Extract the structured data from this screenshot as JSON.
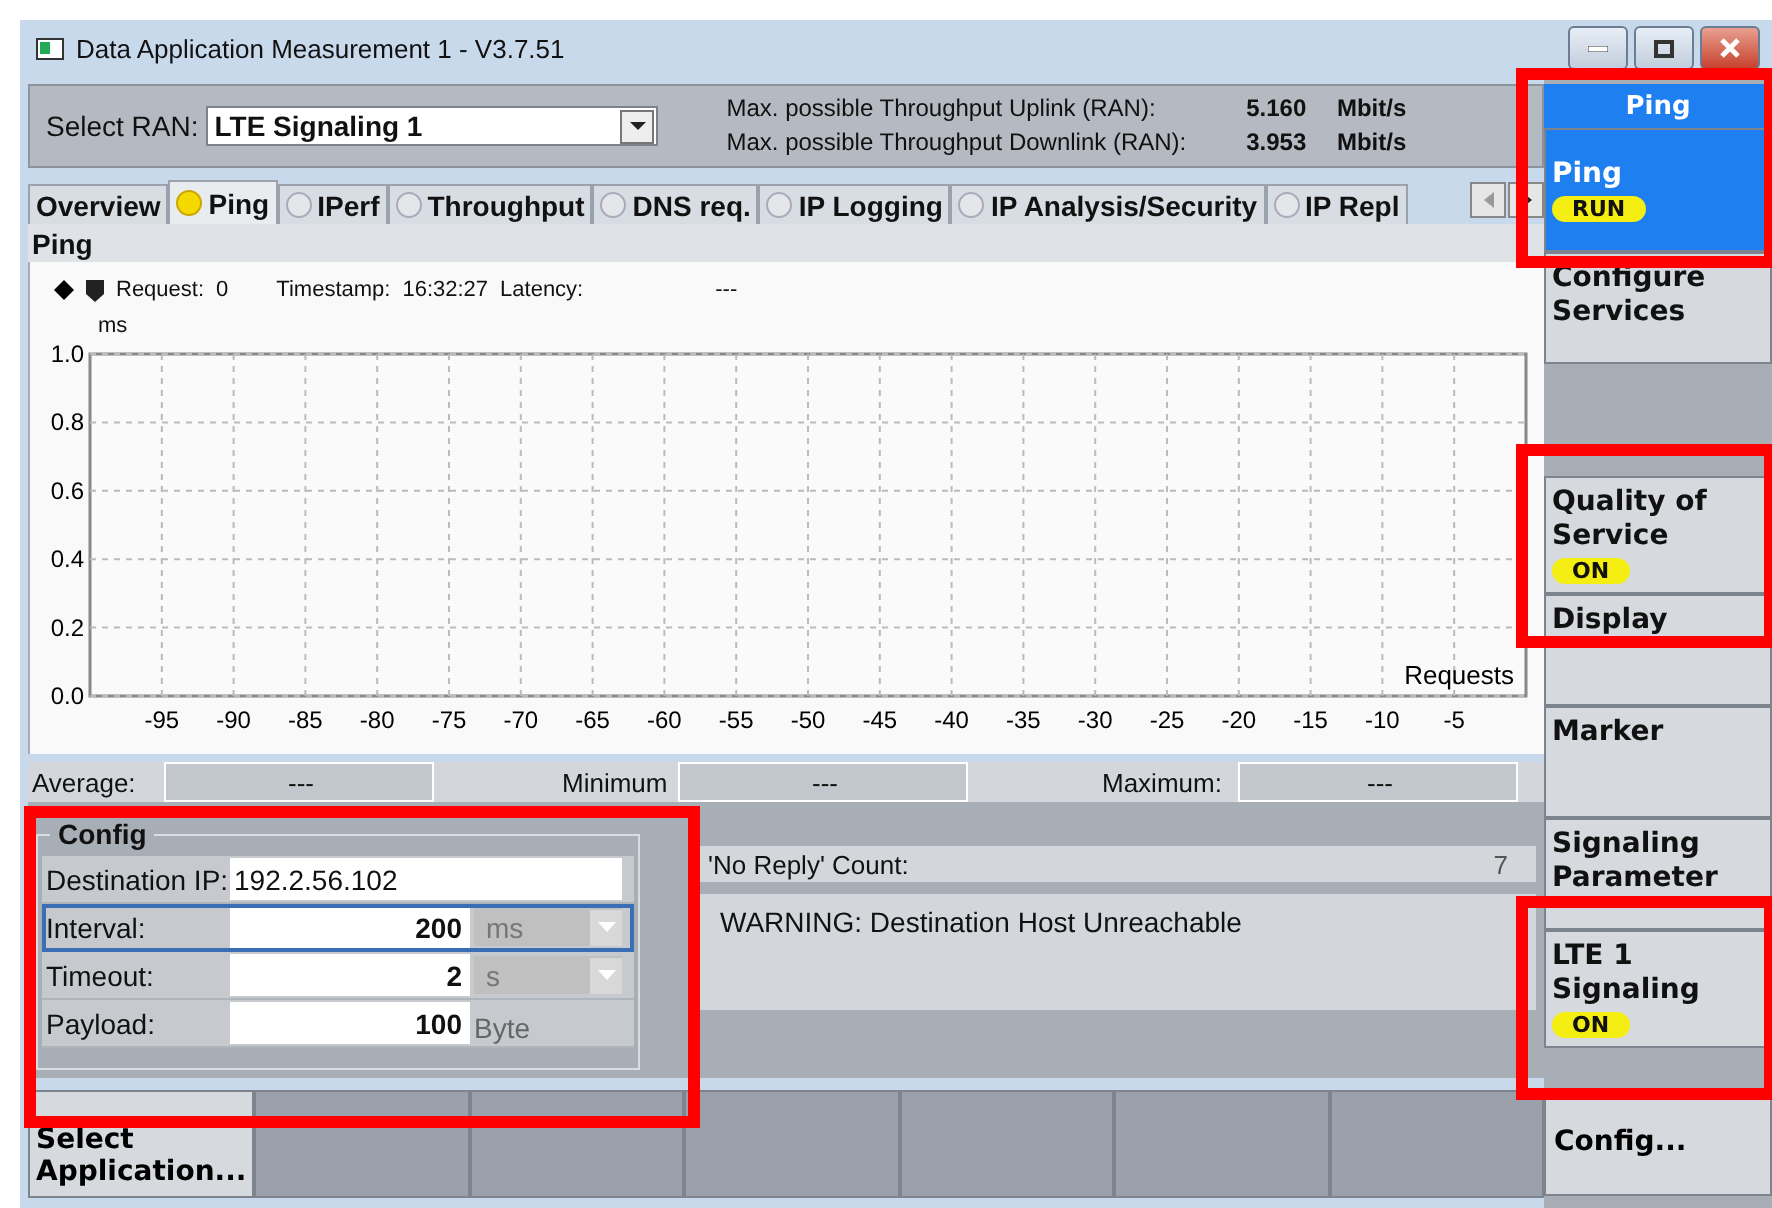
{
  "window": {
    "title": "Data Application Measurement 1 - V3.7.51"
  },
  "ran": {
    "label": "Select RAN:",
    "value": "LTE Signaling 1"
  },
  "throughput": [
    {
      "label": "Max. possible Throughput Uplink (RAN):",
      "value": "5.160",
      "unit": "Mbit/s"
    },
    {
      "label": "Max. possible Throughput Downlink (RAN):",
      "value": "3.953",
      "unit": "Mbit/s"
    }
  ],
  "tabs": [
    {
      "label": "Overview",
      "kind": "plain",
      "selected": false
    },
    {
      "label": "Ping",
      "kind": "led",
      "selected": true,
      "running": true
    },
    {
      "label": "IPerf",
      "kind": "led",
      "selected": false,
      "running": false
    },
    {
      "label": "Throughput",
      "kind": "led",
      "selected": false,
      "running": false
    },
    {
      "label": "DNS req.",
      "kind": "led",
      "selected": false,
      "running": false
    },
    {
      "label": "IP Logging",
      "kind": "led",
      "selected": false,
      "running": false
    },
    {
      "label": "IP Analysis/Security",
      "kind": "led",
      "selected": false,
      "running": false
    },
    {
      "label": "IP Repl",
      "kind": "led",
      "selected": false,
      "running": false
    }
  ],
  "section_title": "Ping",
  "legend": {
    "request_label": "Request:",
    "request": "0",
    "timestamp_label": "Timestamp:",
    "timestamp": "16:32:27",
    "latency_label": "Latency:",
    "latency": "---"
  },
  "chart_data": {
    "type": "line",
    "grid": true,
    "xlabel": "Requests",
    "ylabel": "ms",
    "xlim": [
      -100,
      0
    ],
    "ylim": [
      0,
      1
    ],
    "xticks": [
      -95,
      -90,
      -85,
      -80,
      -75,
      -70,
      -65,
      -60,
      -55,
      -50,
      -45,
      -40,
      -35,
      -30,
      -25,
      -20,
      -15,
      -10,
      -5
    ],
    "yticks": [
      {
        "value": 0,
        "label": "0.0"
      },
      {
        "value": 0.2,
        "label": "0.2"
      },
      {
        "value": 0.4,
        "label": "0.4"
      },
      {
        "value": 0.6,
        "label": "0.6"
      },
      {
        "value": 0.8,
        "label": "0.8"
      },
      {
        "value": 1,
        "label": "1.0"
      }
    ]
  },
  "stats": [
    {
      "label": "Average:",
      "value": "---"
    },
    {
      "label": "Minimum",
      "value": "---"
    },
    {
      "label": "Maximum:",
      "value": "---"
    }
  ],
  "config": {
    "title": "Config",
    "fields": [
      {
        "label": "Destination IP:",
        "value": "192.2.56.102",
        "kind": "text",
        "focused": false
      },
      {
        "label": "Interval:",
        "value": "200",
        "unit": "ms",
        "kind": "dropdown",
        "focused": true
      },
      {
        "label": "Timeout:",
        "value": "2",
        "unit": "s",
        "kind": "dropdown",
        "focused": false
      },
      {
        "label": "Payload:",
        "value": "100",
        "unit": "Byte",
        "kind": "unit",
        "focused": false
      }
    ]
  },
  "no_reply": {
    "label": "'No Reply' Count:",
    "value": "7"
  },
  "message": "WARNING: Destination Host Unreachable",
  "bottom_keys": [
    {
      "label": "Select Application..."
    }
  ],
  "side": {
    "header": "Ping",
    "keys": [
      {
        "kind": "key",
        "label": "Ping",
        "badge": "RUN",
        "selected": true
      },
      {
        "kind": "key",
        "label": "Configure Services",
        "selected": false
      },
      {
        "kind": "gap"
      },
      {
        "kind": "key",
        "label": "Quality of Service",
        "badge": "ON",
        "selected": false
      },
      {
        "kind": "key",
        "label": "Display",
        "selected": false
      },
      {
        "kind": "key",
        "label": "Marker",
        "selected": false
      },
      {
        "kind": "key",
        "label": "Signaling Parameter",
        "selected": false
      },
      {
        "kind": "key",
        "label": "LTE 1 Signaling",
        "badge": "ON",
        "selected": false
      }
    ],
    "bottom": "Config..."
  }
}
